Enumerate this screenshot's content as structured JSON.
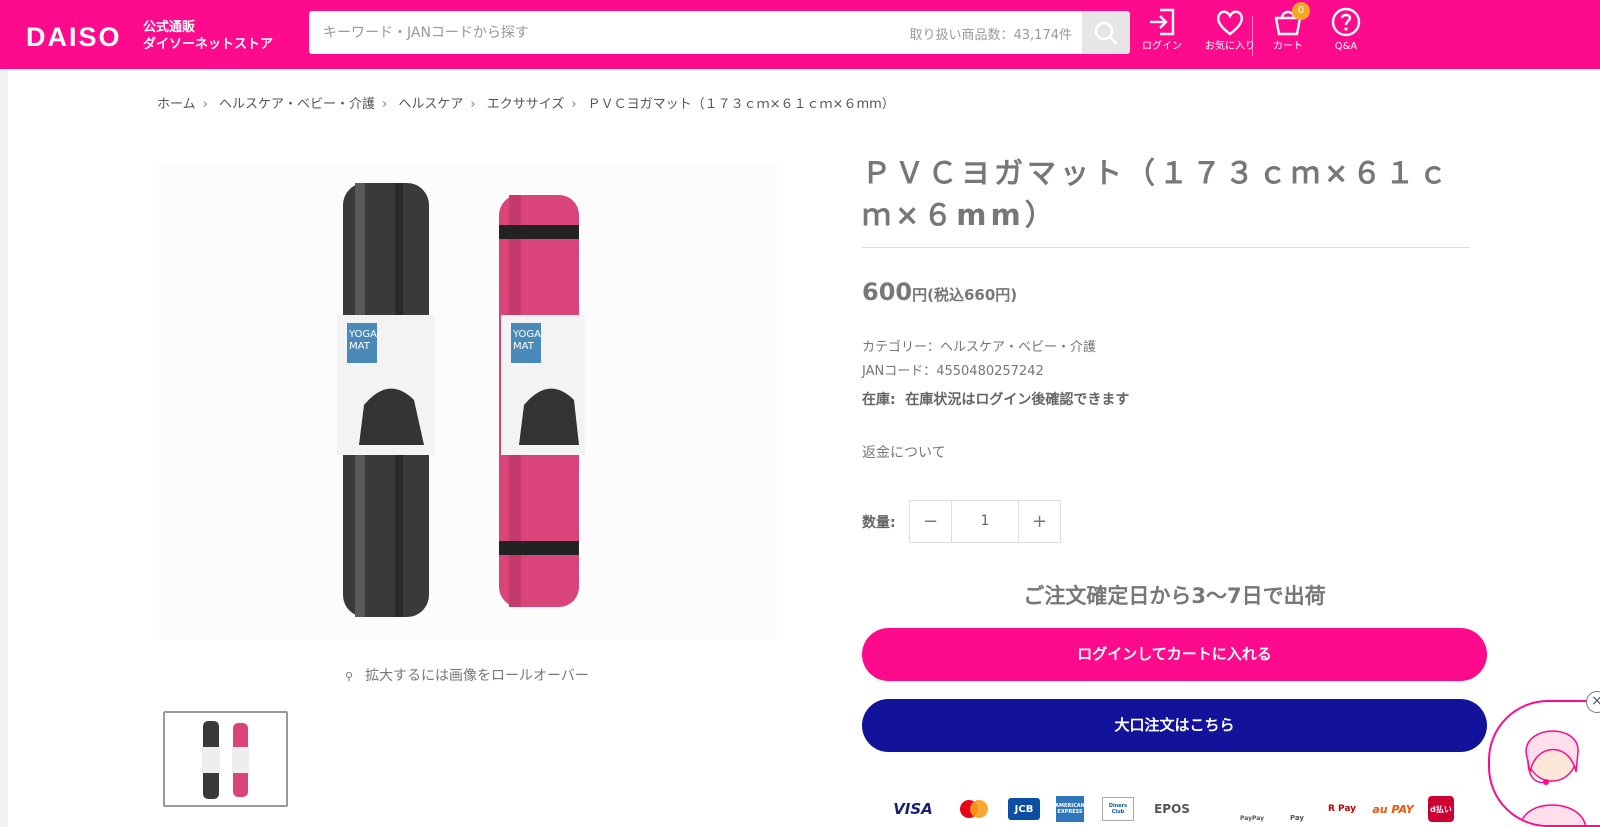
{
  "header": {
    "logo": "DAISO",
    "logo_sub_1": "公式通販",
    "logo_sub_2": "ダイソーネットストア",
    "search_placeholder": "キーワード・JANコードから探す",
    "search_count": "取り扱い商品数：43,174件",
    "login_label": "ログイン",
    "favorites_label": "お気に入り",
    "cart_label": "カート",
    "cart_count": "0",
    "qa_label": "Q&A",
    "brand_color": "#fe0a8c"
  },
  "breadcrumb": [
    "ホーム",
    "ヘルスケア・ベビー・介護",
    "ヘルスケア",
    "エクササイズ",
    "ＰＶＣヨガマット（１７３ｃｍ×６１ｃｍ×６mm）"
  ],
  "gallery": {
    "zoom_hint": "拡大するには画像をロールオーバー",
    "package_text_1": "YOGA",
    "package_text_2": "MAT"
  },
  "product": {
    "title": "ＰＶＣヨガマット（１７３ｃｍ×６１ｃｍ×６mm）",
    "price": "600",
    "price_unit": "円",
    "price_tax": "(税込660円)",
    "category": "カテゴリー：ヘルスケア・ベビー・介護",
    "jan": "JANコード：4550480257242",
    "stock_label": "在庫:",
    "stock_text": "在庫状況はログイン後確認できます",
    "refund_link": "返金について",
    "qty_label": "数量:",
    "qty_value": "1",
    "qty_minus": "−",
    "qty_plus": "+",
    "shipping": "ご注文確定日から3〜7日で出荷",
    "cart_button": "ログインしてカートに入れる",
    "bulk_button": "大口注文はこちら",
    "cart_button_color": "#fe0a8c",
    "bulk_button_color": "#12129a"
  },
  "payments": [
    "VISA",
    "Mastercard",
    "JCB",
    "AMERICAN EXPRESS",
    "Diners Club",
    "EPOS",
    "PayPay",
    "Pay",
    "R Pay",
    "au PAY",
    "d払い"
  ],
  "chat": {
    "close": "×"
  }
}
